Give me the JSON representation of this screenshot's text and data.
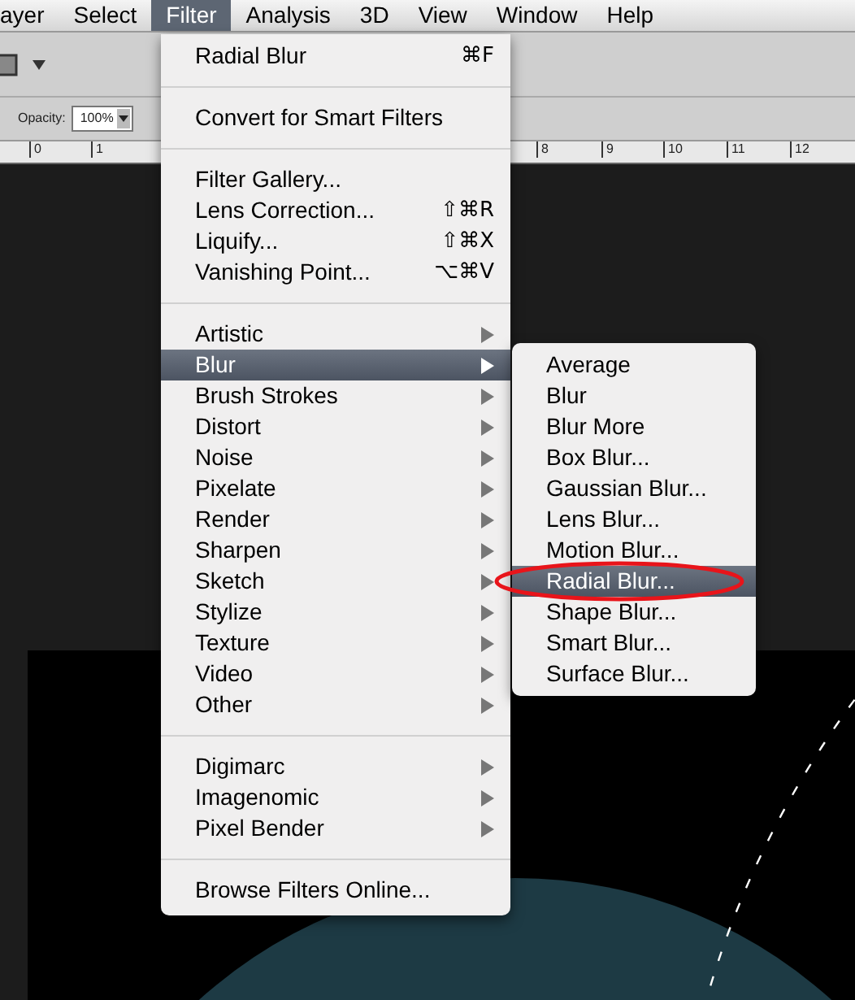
{
  "menu_bar": [
    {
      "label": "ayer",
      "selected": false
    },
    {
      "label": "Select",
      "selected": false
    },
    {
      "label": "Filter",
      "selected": true
    },
    {
      "label": "Analysis",
      "selected": false
    },
    {
      "label": "3D",
      "selected": false
    },
    {
      "label": "View",
      "selected": false
    },
    {
      "label": "Window",
      "selected": false
    },
    {
      "label": "Help",
      "selected": false
    }
  ],
  "options_bar": {
    "opacity_label": "Opacity:",
    "opacity_value": "100%"
  },
  "ruler": {
    "labels": [
      "0",
      "1",
      "8",
      "9",
      "10",
      "11",
      "12"
    ]
  },
  "filter_menu": [
    {
      "kind": "item",
      "label": "Radial Blur",
      "shortcut": "⌘F",
      "selected": false
    },
    {
      "kind": "separator"
    },
    {
      "kind": "item",
      "label": "Convert for Smart Filters",
      "selected": false
    },
    {
      "kind": "separator"
    },
    {
      "kind": "item",
      "label": "Filter Gallery...",
      "selected": false
    },
    {
      "kind": "item",
      "label": "Lens Correction...",
      "shortcut": "⇧⌘R",
      "selected": false
    },
    {
      "kind": "item",
      "label": "Liquify...",
      "shortcut": "⇧⌘X",
      "selected": false
    },
    {
      "kind": "item",
      "label": "Vanishing Point...",
      "shortcut": "⌥⌘V",
      "selected": false
    },
    {
      "kind": "separator"
    },
    {
      "kind": "submenu",
      "label": "Artistic",
      "selected": false
    },
    {
      "kind": "submenu",
      "label": "Blur",
      "selected": true
    },
    {
      "kind": "submenu",
      "label": "Brush Strokes",
      "selected": false
    },
    {
      "kind": "submenu",
      "label": "Distort",
      "selected": false
    },
    {
      "kind": "submenu",
      "label": "Noise",
      "selected": false
    },
    {
      "kind": "submenu",
      "label": "Pixelate",
      "selected": false
    },
    {
      "kind": "submenu",
      "label": "Render",
      "selected": false
    },
    {
      "kind": "submenu",
      "label": "Sharpen",
      "selected": false
    },
    {
      "kind": "submenu",
      "label": "Sketch",
      "selected": false
    },
    {
      "kind": "submenu",
      "label": "Stylize",
      "selected": false
    },
    {
      "kind": "submenu",
      "label": "Texture",
      "selected": false
    },
    {
      "kind": "submenu",
      "label": "Video",
      "selected": false
    },
    {
      "kind": "submenu",
      "label": "Other",
      "selected": false
    },
    {
      "kind": "separator"
    },
    {
      "kind": "submenu",
      "label": "Digimarc",
      "selected": false
    },
    {
      "kind": "submenu",
      "label": "Imagenomic",
      "selected": false
    },
    {
      "kind": "submenu",
      "label": "Pixel Bender",
      "selected": false
    },
    {
      "kind": "separator"
    },
    {
      "kind": "item",
      "label": "Browse Filters Online...",
      "selected": false
    }
  ],
  "blur_submenu": [
    {
      "label": "Average",
      "selected": false
    },
    {
      "label": "Blur",
      "selected": false
    },
    {
      "label": "Blur More",
      "selected": false
    },
    {
      "label": "Box Blur...",
      "selected": false
    },
    {
      "label": "Gaussian Blur...",
      "selected": false
    },
    {
      "label": "Lens Blur...",
      "selected": false
    },
    {
      "label": "Motion Blur...",
      "selected": false
    },
    {
      "label": "Radial Blur...",
      "selected": true
    },
    {
      "label": "Shape Blur...",
      "selected": false
    },
    {
      "label": "Smart Blur...",
      "selected": false
    },
    {
      "label": "Surface Blur...",
      "selected": false
    }
  ]
}
